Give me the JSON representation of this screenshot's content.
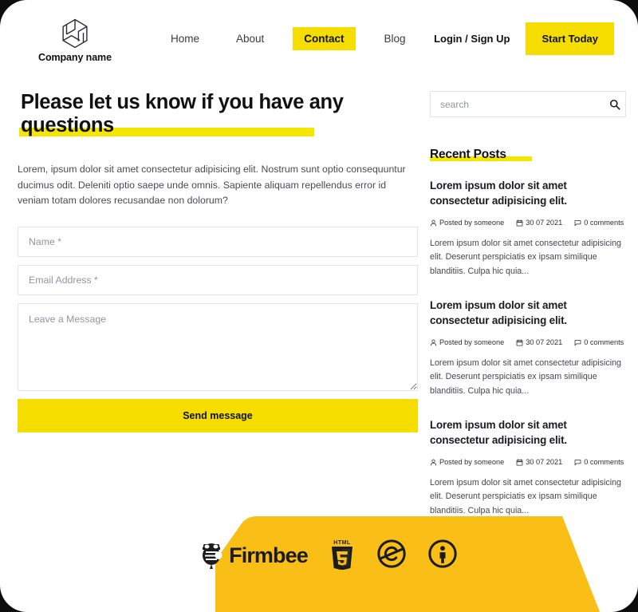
{
  "theme": {
    "accent_yellow": "#f5dd00",
    "highlight_yellow": "#f5e600",
    "footer_yellow": "#f9bf16",
    "text_dark": "#111111",
    "border_grey": "#e2e4e8",
    "placeholder_grey": "#9095a0",
    "page_bg": "#ffffff",
    "outer_bg": "#0d0d0d"
  },
  "header": {
    "brand_name": "Company name",
    "brand_logo_icon": "hexagon-logo-icon",
    "nav": [
      {
        "label": "Home",
        "active": false
      },
      {
        "label": "About",
        "active": false
      },
      {
        "label": "Contact",
        "active": true
      },
      {
        "label": "Blog",
        "active": false
      }
    ],
    "login_label": "Login / Sign Up",
    "cta_label": "Start Today"
  },
  "main": {
    "headline": "Please let us know if you have any questions",
    "intro": "Lorem, ipsum dolor sit amet consectetur adipisicing elit. Nostrum sunt optio consequuntur ducimus odit. Deleniti optio saepe unde omnis. Sapiente aliquam repellendus error id veniam totam dolores recusandae non dolorum?",
    "form": {
      "name_placeholder": "Name *",
      "name_value": "",
      "email_placeholder": "Email Address *",
      "email_value": "",
      "message_placeholder": "Leave a Message",
      "message_value": "",
      "submit_label": "Send message"
    }
  },
  "sidebar": {
    "search": {
      "placeholder": "search",
      "value": "",
      "icon": "search-icon"
    },
    "recent_posts_title": "Recent Posts",
    "posts": [
      {
        "title": "Lorem ipsum dolor sit amet consectetur adipisicing elit.",
        "author": "Posted by someone",
        "date": "30 07 2021",
        "comments": "0 comments",
        "excerpt": "Lorem ipsum dolor sit amet consectetur adipisicing elit. Deserunt perspiciatis ex ipsam similique blanditiis. Culpa hic quia..."
      },
      {
        "title": "Lorem ipsum dolor sit amet consectetur adipisicing elit.",
        "author": "Posted by someone",
        "date": "30 07 2021",
        "comments": "0 comments",
        "excerpt": "Lorem ipsum dolor sit amet consectetur adipisicing elit. Deserunt perspiciatis ex ipsam similique blanditiis. Culpa hic quia..."
      },
      {
        "title": "Lorem ipsum dolor sit amet consectetur adipisicing elit.",
        "author": "Posted by someone",
        "date": "30 07 2021",
        "comments": "0 comments",
        "excerpt": "Lorem ipsum dolor sit amet consectetur adipisicing elit. Deserunt perspiciatis ex ipsam similique blanditiis. Culpa hic quia..."
      }
    ],
    "meta_icons": {
      "author": "user-icon",
      "date": "calendar-icon",
      "comments": "comment-icon"
    }
  },
  "footer": {
    "firmbee_label": "Firmbee",
    "logos": [
      {
        "name": "firmbee-logo",
        "icon": "bee-mascot-icon"
      },
      {
        "name": "html5-logo",
        "icon": "html5-shield-icon"
      },
      {
        "name": "creative-commons-noncommercial-logo",
        "icon": "cc-nc-icon"
      },
      {
        "name": "creative-commons-attribution-logo",
        "icon": "cc-by-icon"
      }
    ]
  }
}
